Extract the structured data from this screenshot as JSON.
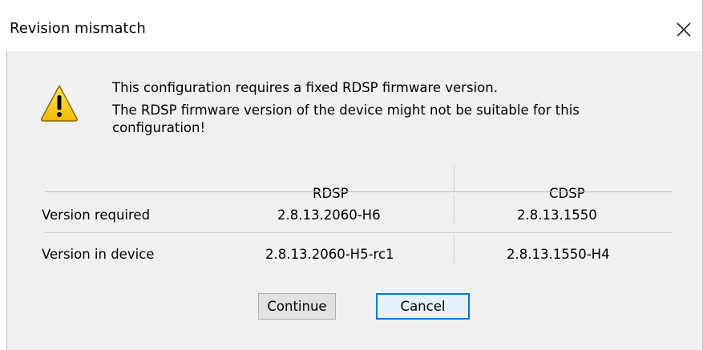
{
  "dialog": {
    "title": "Revision mismatch",
    "close_glyph": "✕",
    "message": {
      "line1": "This configuration requires a fixed RDSP firmware version.",
      "line2": "The RDSP firmware version of the device might not be suitable for this",
      "line3": "configuration!"
    },
    "table": {
      "columns": [
        "RDSP",
        "CDSP"
      ],
      "rows": [
        {
          "label": "Version required",
          "rdsp": "2.8.13.2060-H6",
          "cdsp": "2.8.13.1550"
        },
        {
          "label": "Version in device",
          "rdsp": "2.8.13.2060-H5-rc1",
          "cdsp": "2.8.13.1550-H4"
        }
      ]
    },
    "buttons": {
      "continue": "Continue",
      "cancel": "Cancel"
    },
    "colors": {
      "accent": "#0078d7",
      "warning_yellow": "#f5c400"
    },
    "icons": {
      "warning": "warning-icon",
      "close": "close-icon"
    }
  }
}
